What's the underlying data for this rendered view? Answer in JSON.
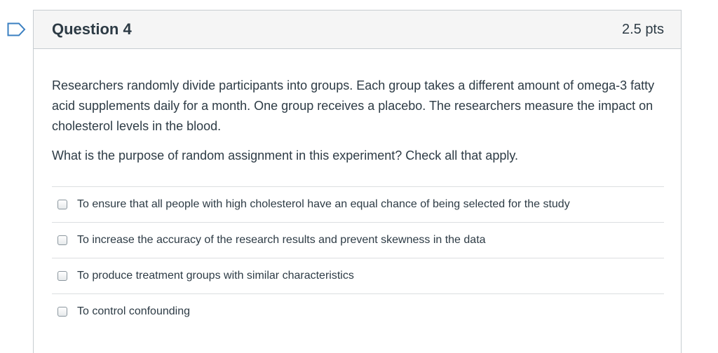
{
  "question": {
    "title": "Question 4",
    "points": "2.5 pts",
    "stem": "Researchers randomly divide participants into groups. Each group takes a different amount of omega-3 fatty acid supplements daily for a month. One group receives a placebo. The researchers measure the impact on cholesterol levels in the blood.",
    "prompt": "What is the purpose of random assignment in this experiment? Check all that apply.",
    "answers": [
      {
        "label": "To ensure that all people with high cholesterol have an equal chance of being selected for the study",
        "checked": false
      },
      {
        "label": "To increase the accuracy of the research results and prevent skewness in the data",
        "checked": false
      },
      {
        "label": "To produce treatment groups with similar characteristics",
        "checked": false
      },
      {
        "label": "To control confounding",
        "checked": false
      }
    ]
  },
  "colors": {
    "text": "#2d3b45",
    "header_bg": "#f5f5f5",
    "border": "#c7cdd1",
    "flag": "#3a7fc1"
  },
  "icons": {
    "flag": "bookmark-flag-icon"
  }
}
